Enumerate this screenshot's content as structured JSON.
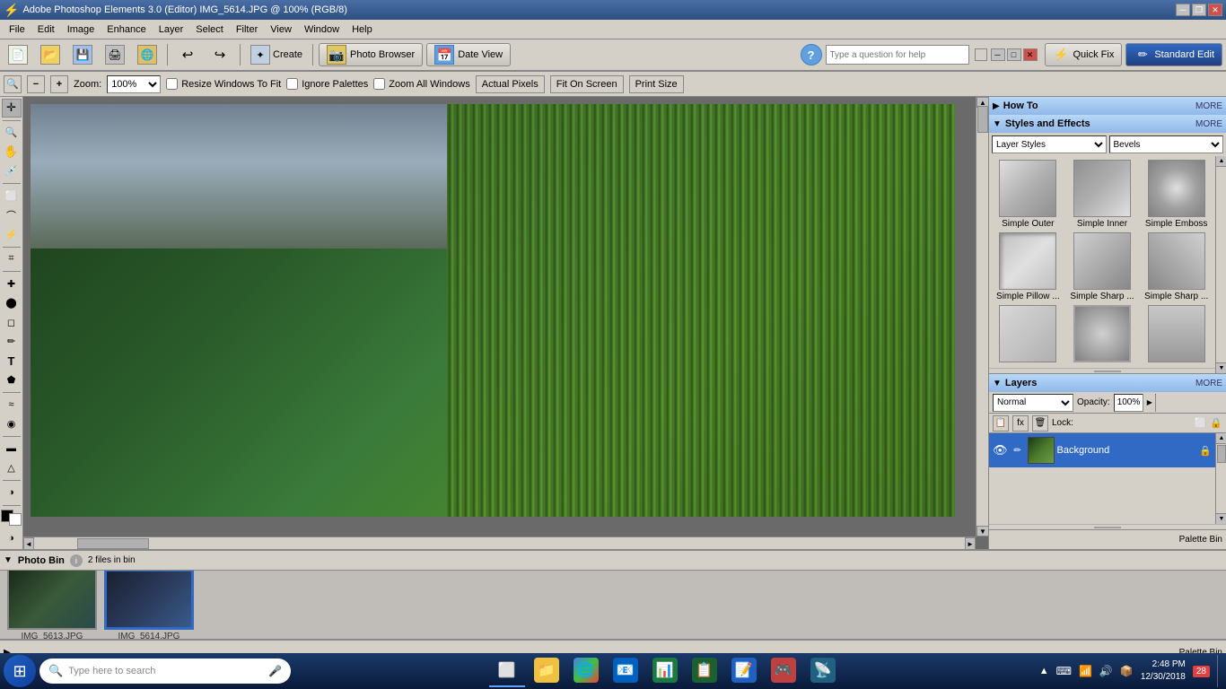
{
  "titlebar": {
    "title": "Adobe Photoshop Elements 3.0 (Editor) IMG_5614.JPG @ 100% (RGB/8)",
    "min_btn": "─",
    "max_btn": "□",
    "close_btn": "✕",
    "restore_btn": "❐"
  },
  "menubar": {
    "items": [
      "File",
      "Edit",
      "Image",
      "Enhance",
      "Layer",
      "Select",
      "Filter",
      "View",
      "Window",
      "Help"
    ]
  },
  "toolbar": {
    "new_btn": "New",
    "photo_browser_btn": "Photo Browser",
    "date_view_btn": "Date View",
    "quick_fix_btn": "Quick Fix",
    "standard_edit_btn": "Standard Edit",
    "help_placeholder": "Type a question for help",
    "create_btn": "Create"
  },
  "options_bar": {
    "zoom_label": "Zoom:",
    "zoom_value": "100%",
    "resize_windows": "Resize Windows To Fit",
    "ignore_palettes": "Ignore Palettes",
    "zoom_all_windows": "Zoom All Windows",
    "actual_pixels": "Actual Pixels",
    "fit_on_screen": "Fit On Screen",
    "print_size": "Print Size"
  },
  "tools": [
    {
      "name": "move",
      "icon": "✛"
    },
    {
      "name": "zoom",
      "icon": "🔍"
    },
    {
      "name": "hand",
      "icon": "✋"
    },
    {
      "name": "eyedropper",
      "icon": "💉"
    },
    {
      "name": "marquee",
      "icon": "⬜"
    },
    {
      "name": "lasso",
      "icon": "🔗"
    },
    {
      "name": "magic-wand",
      "icon": "⚡"
    },
    {
      "name": "crop",
      "icon": "⬛"
    },
    {
      "name": "healing",
      "icon": "✚"
    },
    {
      "name": "clone",
      "icon": "🖈"
    },
    {
      "name": "eraser",
      "icon": "◻"
    },
    {
      "name": "pencil",
      "icon": "✏"
    },
    {
      "name": "type",
      "icon": "T"
    },
    {
      "name": "shape",
      "icon": "⬟"
    },
    {
      "name": "blur",
      "icon": "◎"
    },
    {
      "name": "sponge",
      "icon": "⊕"
    },
    {
      "name": "gradient",
      "icon": "▬"
    },
    {
      "name": "paint-bucket",
      "icon": "🪣"
    },
    {
      "name": "dodge",
      "icon": "◑"
    },
    {
      "name": "custom-shape",
      "icon": "★"
    },
    {
      "name": "foreground",
      "icon": "■"
    },
    {
      "name": "background",
      "icon": "□"
    },
    {
      "name": "quick-mask",
      "icon": "◑"
    }
  ],
  "right_panel": {
    "howto": {
      "title": "How To",
      "more": "MORE"
    },
    "styles": {
      "title": "Styles and Effects",
      "more": "MORE",
      "category1": "Layer Styles",
      "category2": "Bevels",
      "items": [
        {
          "label": "Simple Outer",
          "class": "bevel-simple-outer"
        },
        {
          "label": "Simple Inner",
          "class": "bevel-simple-inner"
        },
        {
          "label": "Simple Emboss",
          "class": "bevel-simple-emboss"
        },
        {
          "label": "Simple Pillow ...",
          "class": "bevel-simple-pillow"
        },
        {
          "label": "Simple Sharp ...",
          "class": "bevel-simple-sharp1"
        },
        {
          "label": "Simple Sharp ...",
          "class": "bevel-simple-sharp2"
        },
        {
          "label": "",
          "class": "bevel-row3a"
        },
        {
          "label": "",
          "class": "bevel-row3b"
        },
        {
          "label": "",
          "class": "bevel-row3c"
        }
      ]
    },
    "layers": {
      "title": "Layers",
      "more": "MORE",
      "mode": "Normal",
      "opacity_label": "Opacity:",
      "opacity_value": "100%",
      "lock_label": "Lock:",
      "items": [
        {
          "name": "Background",
          "selected": true
        }
      ]
    }
  },
  "photo_bin": {
    "title": "Photo Bin",
    "info": "2 files in bin",
    "photos": [
      {
        "name": "IMG_5613.JPG",
        "selected": false
      },
      {
        "name": "IMG_5614.JPG",
        "selected": true
      }
    ]
  },
  "taskbar": {
    "search_placeholder": "Type here to search",
    "time": "2:48 PM",
    "date": "12/30/2018",
    "notification_count": "28"
  },
  "palette_bin": {
    "label": "Palette Bin"
  },
  "status_bar": {
    "arrow": "▶",
    "palette_bin_label": "Palette Bin"
  }
}
